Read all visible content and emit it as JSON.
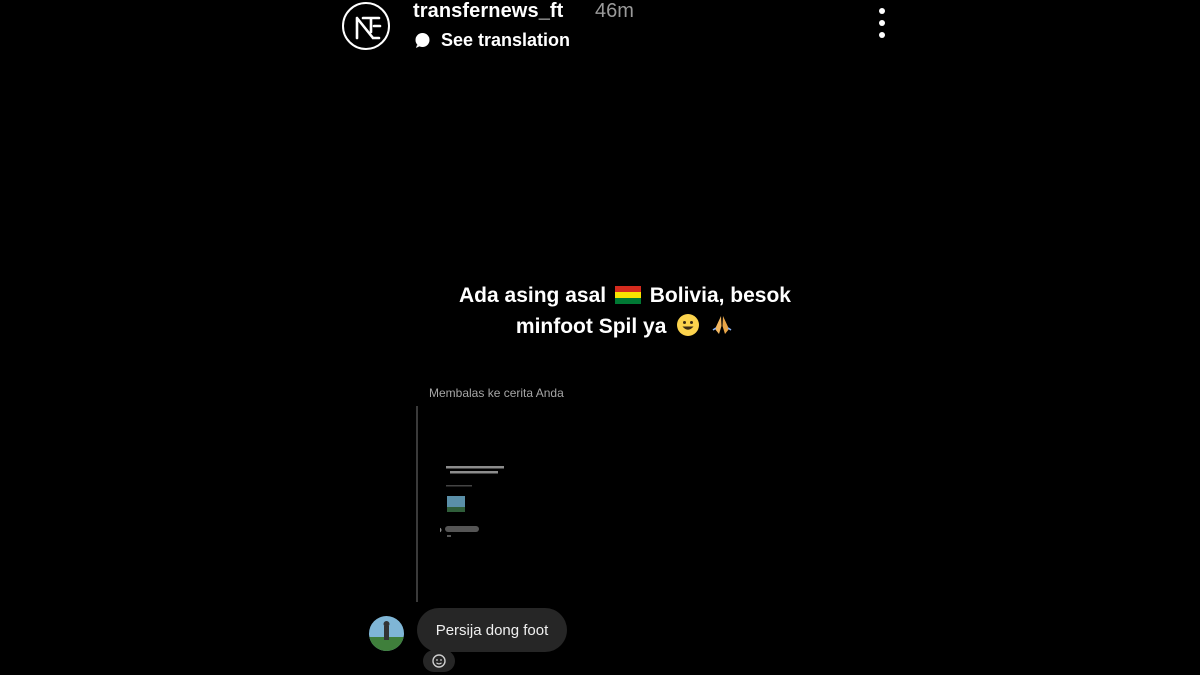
{
  "header": {
    "username": "transfernews_ft",
    "time": "46m",
    "see_translation": "See translation",
    "logo_icon": "tnft-logo-icon",
    "more_icon": "more-vertical-icon"
  },
  "story": {
    "caption_line1_before_flag": "Ada asing asal",
    "caption_line1_after_flag": "Bolivia, besok",
    "caption_line2": "minfoot Spil ya",
    "flag_icon": "bolivia-flag-icon",
    "emoji_icons": [
      "grinning-face-icon",
      "folded-hands-icon"
    ]
  },
  "reply": {
    "label": "Membalas ke cerita Anda"
  },
  "message": {
    "text": "Persija dong foot",
    "react_icon": "add-reaction-icon"
  },
  "colors": {
    "background": "#000000",
    "bubble": "#262626",
    "muted_text": "#9a9a9a",
    "flag_red": "#d52b1e",
    "flag_yellow": "#f9e300",
    "flag_green": "#007934"
  }
}
